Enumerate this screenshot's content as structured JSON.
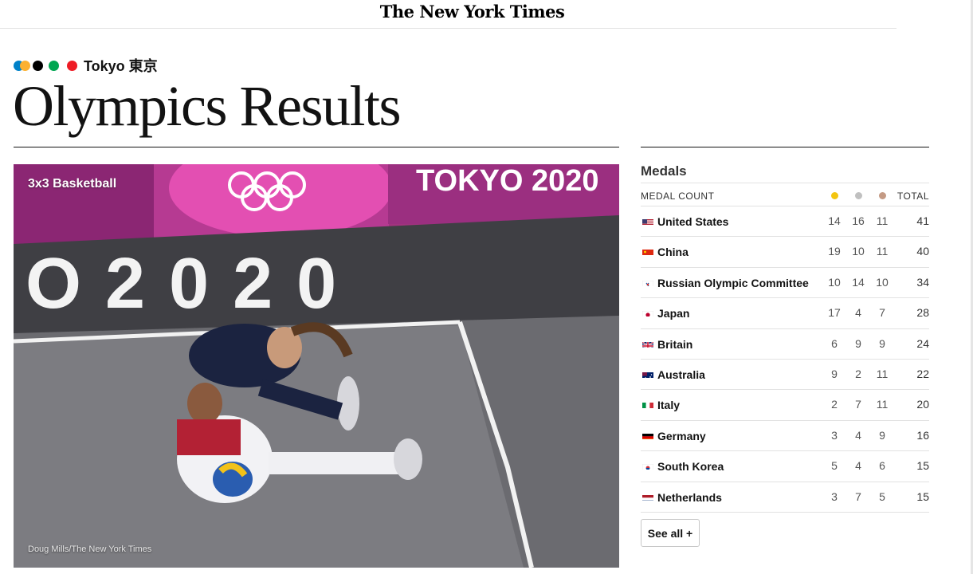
{
  "masthead": {
    "logo": "The New York Times"
  },
  "kicker": {
    "label": "Tokyo 東京",
    "ring_colors": [
      "#0081c8",
      "#fcb131",
      "#000000",
      "#00a651",
      "#ee1c25"
    ]
  },
  "page_title": "Olympics Results",
  "photo": {
    "label": "3x3 Basketball",
    "credit": "Doug Mills/The New York Times",
    "banner_text": "TOKYO 2020",
    "court_text": "O2020"
  },
  "medals": {
    "title": "Medals",
    "header": {
      "label": "MEDAL COUNT",
      "total": "TOTAL"
    },
    "medal_colors": {
      "gold": "#f3c511",
      "silver": "#c0c0c0",
      "bronze": "#c49a84"
    },
    "rows": [
      {
        "flag": "us-flag",
        "country": "United States",
        "gold": "14",
        "silver": "16",
        "bronze": "11",
        "total": "41"
      },
      {
        "flag": "china-flag",
        "country": "China",
        "gold": "19",
        "silver": "10",
        "bronze": "11",
        "total": "40"
      },
      {
        "flag": "roc-flag",
        "country": "Russian Olympic Committee",
        "gold": "10",
        "silver": "14",
        "bronze": "10",
        "total": "34"
      },
      {
        "flag": "japan-flag",
        "country": "Japan",
        "gold": "17",
        "silver": "4",
        "bronze": "7",
        "total": "28"
      },
      {
        "flag": "britain-flag",
        "country": "Britain",
        "gold": "6",
        "silver": "9",
        "bronze": "9",
        "total": "24"
      },
      {
        "flag": "australia-flag",
        "country": "Australia",
        "gold": "9",
        "silver": "2",
        "bronze": "11",
        "total": "22"
      },
      {
        "flag": "italy-flag",
        "country": "Italy",
        "gold": "2",
        "silver": "7",
        "bronze": "11",
        "total": "20"
      },
      {
        "flag": "germany-flag",
        "country": "Germany",
        "gold": "3",
        "silver": "4",
        "bronze": "9",
        "total": "16"
      },
      {
        "flag": "south-korea-flag",
        "country": "South Korea",
        "gold": "5",
        "silver": "4",
        "bronze": "6",
        "total": "15"
      },
      {
        "flag": "netherlands-flag",
        "country": "Netherlands",
        "gold": "3",
        "silver": "7",
        "bronze": "5",
        "total": "15"
      }
    ],
    "see_all": "See all +"
  }
}
